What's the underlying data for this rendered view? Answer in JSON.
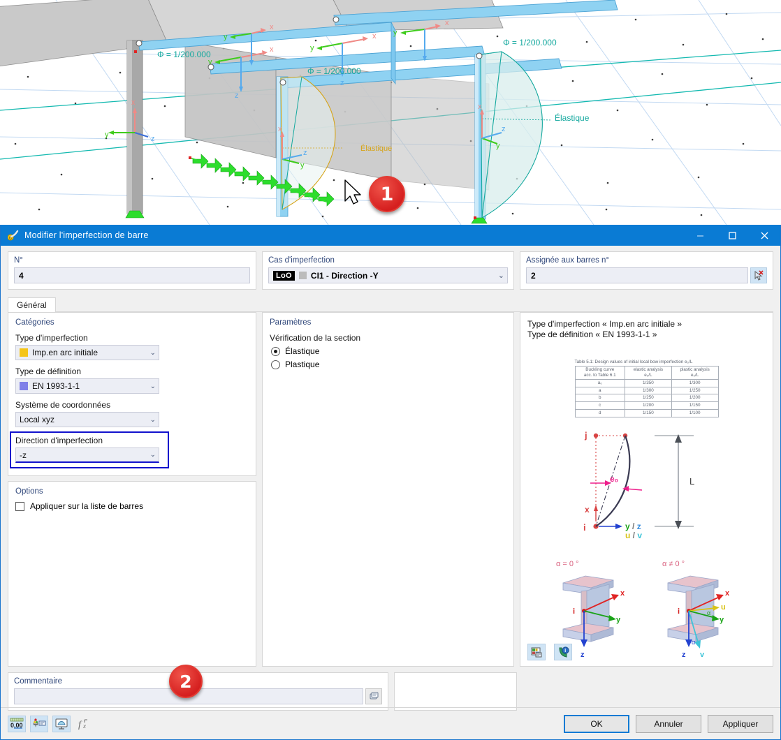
{
  "viewport": {
    "labels": {
      "phi1": "Φ = 1/200.000",
      "phi2": "Φ = 1/200.000",
      "phi3": "Φ = 1/200.000",
      "elastique_right": "Élastique",
      "elastique_mid": "Élastique",
      "axis_x": "x",
      "axis_y": "y",
      "axis_z": "z"
    },
    "colors": {
      "axis_x": "#e8928e",
      "axis_y": "#3fcc1c",
      "axis_z": "#55aaee",
      "member_selected": "#7ecbf0",
      "member_grey": "#9d9d9d",
      "annotation_teal": "#13a89e",
      "annotation_gold": "#d6a418",
      "load_arrow": "#2ddd2d",
      "grid": "#bcd6f0"
    }
  },
  "callouts": [
    {
      "id": "1",
      "label": "1"
    },
    {
      "id": "2",
      "label": "2"
    }
  ],
  "window": {
    "title": "Modifier l'imperfection de barre",
    "icon": "member-imperfection-icon",
    "minimize": "—",
    "maximize": "□",
    "close": "✕",
    "titlebar_color": "#0a7bd4"
  },
  "header_fields": {
    "number": {
      "label": "N°",
      "value": "4"
    },
    "imperfection_case": {
      "label": "Cas d'imperfection",
      "tag": "LoO",
      "value": "CI1 - Direction -Y",
      "swatch": "#bcbcbc"
    },
    "assigned_members": {
      "label": "Assignée aux barres n°",
      "value": "2",
      "pick_icon": "select-members-icon"
    }
  },
  "tabs": [
    {
      "label": "Général",
      "active": true
    }
  ],
  "categories": {
    "title": "Catégories",
    "imperfection_type": {
      "label": "Type d'imperfection",
      "value": "Imp.en arc initiale",
      "swatch": "#f5c518"
    },
    "definition_type": {
      "label": "Type de définition",
      "value": "EN 1993-1-1",
      "swatch": "#8080e8"
    },
    "coordinate_system": {
      "label": "Système de coordonnées",
      "value": "Local xyz"
    },
    "imperfection_direction": {
      "label": "Direction d'imperfection",
      "value": "-z",
      "highlighted": true,
      "highlight_color": "#1111cc"
    }
  },
  "options": {
    "title": "Options",
    "apply_to_member_list": {
      "label": "Appliquer sur la liste de barres",
      "checked": false
    }
  },
  "parameters": {
    "title": "Paramètres",
    "section_check": {
      "label": "Vérification de la section",
      "selected": "Élastique",
      "choices": [
        {
          "label": "Élastique",
          "selected": true
        },
        {
          "label": "Plastique",
          "selected": false
        }
      ]
    }
  },
  "info_panel": {
    "line1": "Type d'imperfection « Imp.en arc initiale »",
    "line2": "Type de définition « EN 1993-1-1 »",
    "table": {
      "caption": "Table 5.1: Design values of initial local bow imperfection e₀/L",
      "headers": [
        "Buckling curve acc. to Table 6.1",
        "elastic analysis e₀/L",
        "plastic analysis e₀/L"
      ],
      "header_lines": [
        [
          "Buckling curve",
          "acc. to Table 6.1"
        ],
        [
          "elastic analysis",
          "e₀/L"
        ],
        [
          "plastic analysis",
          "e₀/L"
        ]
      ],
      "rows": [
        [
          "a₀",
          "1/350",
          "1/300"
        ],
        [
          "a",
          "1/300",
          "1/250"
        ],
        [
          "b",
          "1/250",
          "1/200"
        ],
        [
          "c",
          "1/200",
          "1/150"
        ],
        [
          "d",
          "1/150",
          "1/100"
        ]
      ]
    },
    "bow_diagram": {
      "node_j": "j",
      "node_i": "i",
      "offset_label": "e₀",
      "length_label": "L",
      "axis_x": "x",
      "axis_yz": "y / z",
      "axis_uv": "u / v"
    },
    "section_diagrams": [
      {
        "caption": "α = 0 °",
        "labels": [
          "i",
          "x",
          "y",
          "z"
        ]
      },
      {
        "caption": "α ≠ 0 °",
        "labels": [
          "i",
          "x",
          "u",
          "y",
          "α",
          "z",
          "v"
        ]
      }
    ],
    "footer_icons": [
      {
        "name": "image-settings-icon"
      },
      {
        "name": "info-icon"
      }
    ]
  },
  "comment": {
    "label": "Commentaire",
    "value": "",
    "placeholder": "",
    "button_icon": "comment-library-icon"
  },
  "bottom_toolbar": [
    {
      "name": "decimal-places-icon",
      "label": "0,00",
      "active": true
    },
    {
      "name": "display-properties-icon",
      "active": true
    },
    {
      "name": "render-view-icon",
      "active": true
    },
    {
      "name": "formula-icon",
      "active": false
    }
  ],
  "dialog_buttons": {
    "ok": "OK",
    "cancel": "Annuler",
    "apply": "Appliquer"
  }
}
